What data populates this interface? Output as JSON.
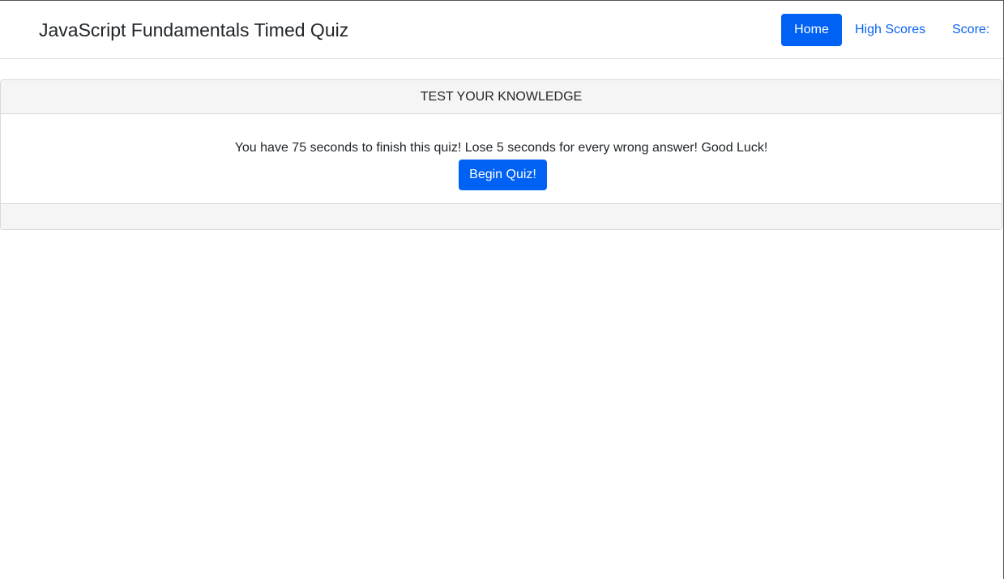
{
  "navbar": {
    "brand": "JavaScript Fundamentals Timed Quiz",
    "home_label": "Home",
    "high_scores_label": "High Scores",
    "score_label": "Score:"
  },
  "quiz_card": {
    "header": "TEST YOUR KNOWLEDGE",
    "instructions": "You have 75 seconds to finish this quiz! Lose 5 seconds for every wrong answer! Good Luck!",
    "begin_label": "Begin Quiz!"
  },
  "colors": {
    "primary": "#0062f5",
    "link": "#0a63f2",
    "card_bg": "#f5f5f5",
    "border": "#d9d9d9"
  }
}
